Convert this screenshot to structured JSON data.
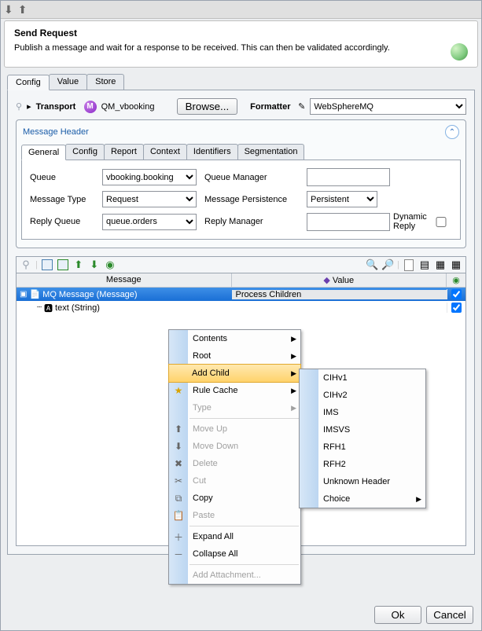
{
  "title": "Send Request",
  "description": "Publish a message and wait for a response to be received.  This can then be validated accordingly.",
  "mainTabs": [
    "Config",
    "Value",
    "Store"
  ],
  "mainTabActive": 0,
  "transportLabel": "Transport",
  "transportValue": "QM_vbooking",
  "browseBtn": "Browse...",
  "formatterLabel": "Formatter",
  "formatterValue": "WebSphereMQ",
  "msgHeaderTitle": "Message Header",
  "headerTabs": [
    "General",
    "Config",
    "Report",
    "Context",
    "Identifiers",
    "Segmentation"
  ],
  "headerTabActive": 0,
  "fields": {
    "queueLabel": "Queue",
    "queueValue": "vbooking.booking",
    "queueMgrLabel": "Queue Manager",
    "queueMgrValue": "",
    "msgTypeLabel": "Message Type",
    "msgTypeValue": "Request",
    "msgPersistLabel": "Message Persistence",
    "msgPersistValue": "Persistent",
    "replyQueueLabel": "Reply Queue",
    "replyQueueValue": "queue.orders",
    "replyMgrLabel": "Reply Manager",
    "replyMgrValue": "",
    "dynReplyLabel": "Dynamic Reply"
  },
  "treeHeaders": {
    "col1": "Message",
    "col2": "Value"
  },
  "treeRows": [
    {
      "label": "MQ Message (Message)",
      "value": "Process Children",
      "checked": true,
      "selected": true,
      "indent": 0
    },
    {
      "label": "text (String)",
      "value": "",
      "checked": true,
      "selected": false,
      "indent": 1
    }
  ],
  "contextMenu": [
    {
      "label": "Contents",
      "sub": true
    },
    {
      "label": "Root",
      "sub": true
    },
    {
      "label": "Add Child",
      "sub": true,
      "highlight": true
    },
    {
      "label": "Rule Cache",
      "sub": true,
      "icon": "★",
      "iconColor": "#d9a300"
    },
    {
      "label": "Type",
      "sub": true,
      "disabled": true
    },
    {
      "sep": true
    },
    {
      "label": "Move Up",
      "disabled": true,
      "icon": "⬆"
    },
    {
      "label": "Move Down",
      "disabled": true,
      "icon": "⬇"
    },
    {
      "label": "Delete",
      "disabled": true,
      "icon": "✖"
    },
    {
      "label": "Cut",
      "disabled": true,
      "icon": "✂"
    },
    {
      "label": "Copy",
      "icon": "⧉"
    },
    {
      "label": "Paste",
      "disabled": true,
      "icon": "📋"
    },
    {
      "sep": true
    },
    {
      "label": "Expand All",
      "icon": "＋"
    },
    {
      "label": "Collapse All",
      "icon": "－"
    },
    {
      "sep": true
    },
    {
      "label": "Add Attachment...",
      "disabled": true
    }
  ],
  "subMenu": [
    "CIHv1",
    "CIHv2",
    "IMS",
    "IMSVS",
    "RFH1",
    "RFH2",
    "Unknown Header",
    {
      "label": "Choice",
      "sub": true
    }
  ],
  "footer": {
    "ok": "Ok",
    "cancel": "Cancel"
  }
}
